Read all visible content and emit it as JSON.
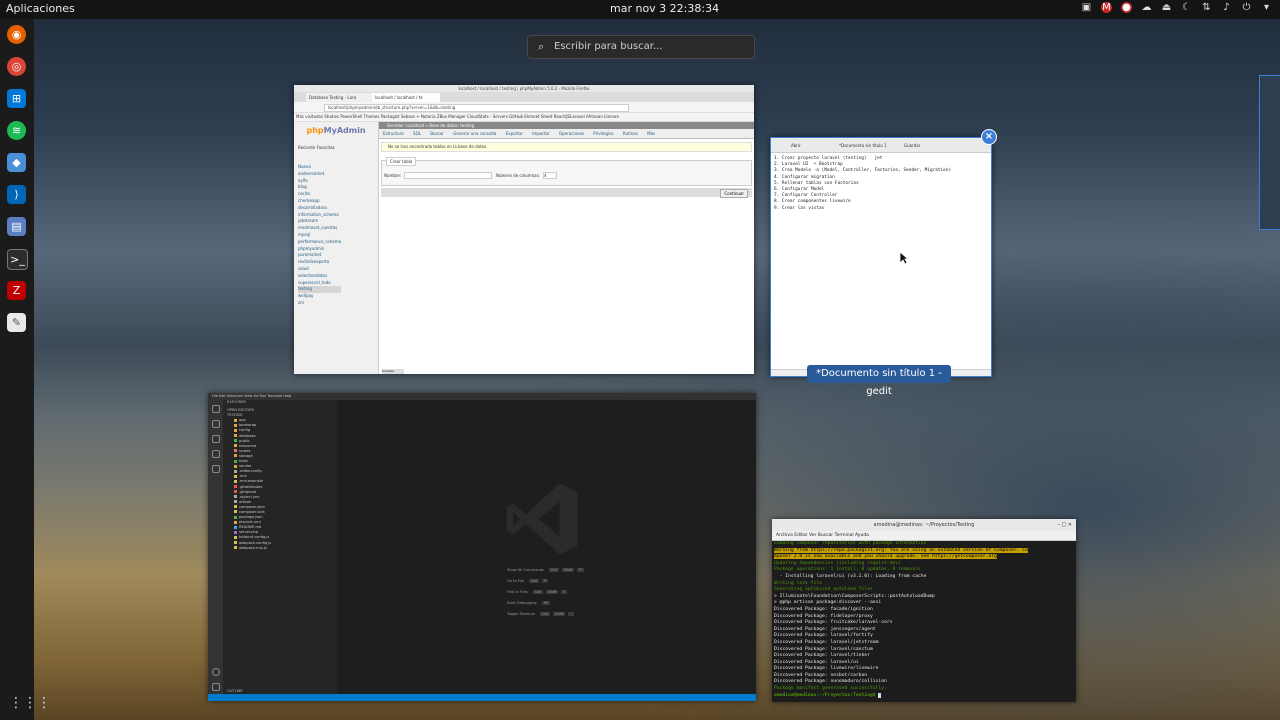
{
  "topbar": {
    "apps": "Aplicaciones",
    "clock": "mar nov 3  22:38:34"
  },
  "search": {
    "placeholder": "Escribir para buscar..."
  },
  "firefox": {
    "title": "localhost / localhost / testing | phpMyAdmin 5.0.2 - Mozilla Firefox",
    "tabs": [
      "Database Testing - Lara",
      "localhost / localhost / te"
    ],
    "url": "localhost/phpmyadmin/db_structure.php?server=1&db=testing",
    "bookmarks": "Más visitados  Studies  PowerShell  Themes  Packagist  Sebass + Notaria  ZBox Manager  CloudStats - Servers  GitHub  Ekmnet Sheet  React/JSLaravel  Ahtnean  Llenare",
    "pma": {
      "logo_php": "php",
      "logo_rest": "MyAdmin",
      "recent": "Reciente  Favoritas",
      "databases": [
        "Nueva",
        "andesmarket",
        "aylfo",
        "blog",
        "cecite",
        "checkeapp",
        "desarrolladora",
        "information_schema",
        "jobstream",
        "medmoost_cuentas",
        "mysql",
        "performance_schema",
        "phpmyadmin",
        "puremarket",
        "revitalisexperto",
        "salud",
        "selectiondatos",
        "superaccel_todo",
        "testing",
        "wellpay",
        "zm"
      ],
      "selected_db": "testing",
      "breadcrumb": "Servidor: localhost » Base de datos: testing",
      "nav": [
        "Estructura",
        "SQL",
        "Buscar",
        "Generar una consulta",
        "Exportar",
        "Importar",
        "Operaciones",
        "Privilegios",
        "Rutinas",
        "Más"
      ],
      "notice": "No se han encontrado tablas en la base de datos.",
      "create_legend": "Crear tabla",
      "name_label": "Nombre:",
      "cols_label": "Número de columnas:",
      "cols_value": "4",
      "continue": "Continuar",
      "console": "Consola"
    }
  },
  "gedit": {
    "header": [
      "Abrir",
      "*Documento sin título 1",
      "Guardar"
    ],
    "text": "1. Crear proyecto laravel (testing)   jet\n2. Laravel UI  + Bootstrap\n3. Crea Modelo -a (Model, Controller, Factories, Seeder, Migration)\n4. Configurar migration\n5. Rellenar tablas con Factorias\n6. Configurar Model\n7. Configurar Controller\n8. Crear componentes livewire\n9. Crear las vistas",
    "label": "*Documento sin título 1 - gedit"
  },
  "vscode": {
    "menu": "File  Edit  Selection  View  Go  Run  Terminal  Help",
    "explorer": "EXPLORER",
    "open_editors": "OPEN EDITORS",
    "project": "TESTING",
    "folders": [
      "app",
      "bootstrap",
      "config",
      "database",
      "public",
      "resources",
      "routes",
      "storage",
      "tests",
      "vendor"
    ],
    "files": [
      ".editorconfig",
      ".env",
      ".env.example",
      ".gitattributes",
      ".gitignore",
      ".styleci.yml",
      "artisan",
      "composer.json",
      "composer.lock",
      "package.json",
      "phpunit.xml",
      "README.md",
      "server.php",
      "tailwind.config.js",
      "webpack.config.js",
      "webpack.mix.js"
    ],
    "outline": "OUTLINE",
    "shortcuts": [
      {
        "label": "Show All Commands",
        "keys": [
          "Ctrl",
          "Shift",
          "P"
        ]
      },
      {
        "label": "Go to File",
        "keys": [
          "Ctrl",
          "P"
        ]
      },
      {
        "label": "Find in Files",
        "keys": [
          "Ctrl",
          "Shift",
          "F"
        ]
      },
      {
        "label": "Start Debugging",
        "keys": [
          "F5"
        ]
      },
      {
        "label": "Toggle Terminal",
        "keys": [
          "Ctrl",
          "Shift",
          "`"
        ]
      }
    ]
  },
  "terminal": {
    "title": "amedina@medinas: ~/Proyectos/Testing",
    "menu": "Archivo   Editar   Ver   Buscar   Terminal   Ayuda",
    "lines": [
      "Loading composer repositories with package information",
      "Warning from https://repo.packagist.org: You are using an outdated version of Composer. Co",
      "mposer 2.0 is now available and you should upgrade. See https://getcomposer.org",
      "Updating dependencies (including require-dev)",
      "Package operations: 1 install, 0 updates, 0 removals",
      "  - Installing laravel/ui (v3.1.0): Loading from cache",
      "Writing lock file",
      "Generating optimized autoload files",
      "> Illuminate\\Foundation\\ComposerScripts::postAutoloadDump",
      "> @php artisan package:discover --ansi",
      "Discovered Package: facade/ignition",
      "Discovered Package: fideloper/proxy",
      "Discovered Package: fruitcake/laravel-cors",
      "Discovered Package: jenssegers/agent",
      "Discovered Package: laravel/fortify",
      "Discovered Package: laravel/jetstream",
      "Discovered Package: laravel/sanctum",
      "Discovered Package: laravel/tinker",
      "Discovered Package: laravel/ui",
      "Discovered Package: livewire/livewire",
      "Discovered Package: nesbot/carbon",
      "Discovered Package: nunomaduro/collision",
      "Package manifest generated successfully.",
      "amedina@medinas:~/Proyectos/Testing$ "
    ]
  }
}
